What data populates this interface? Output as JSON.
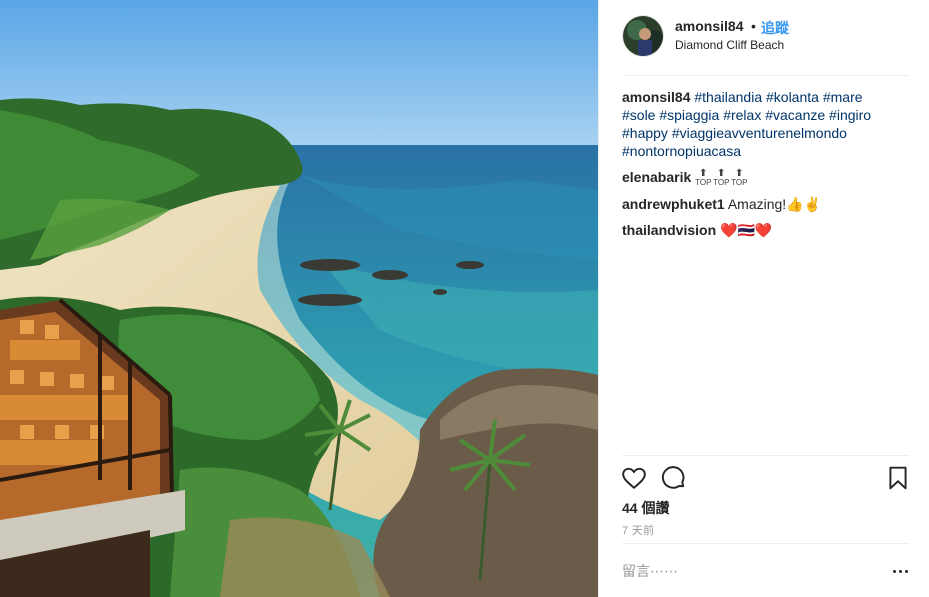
{
  "post": {
    "username": "amonsil84",
    "separator": "•",
    "follow_label": "追蹤",
    "location": "Diamond Cliff Beach"
  },
  "comments": [
    {
      "username": "amonsil84",
      "tags": [
        "#thailandia",
        "#kolanta",
        "#mare",
        "#sole",
        "#spiaggia",
        "#relax",
        "#vacanze",
        "#ingiro",
        "#happy",
        "#viaggieavventurenelmondo",
        "#nontornopiuacasa"
      ]
    },
    {
      "username": "elenabarik",
      "emoji_label": "TOP",
      "emoji_arrow": "⬆"
    },
    {
      "username": "andrewphuket1",
      "text": "Amazing!",
      "emoji": "👍✌️"
    },
    {
      "username": "thailandvision",
      "emoji": "❤️🇹🇭❤️"
    }
  ],
  "actions": {
    "like_icon": "heart-icon",
    "comment_icon": "comment-bubble-icon",
    "save_icon": "bookmark-icon"
  },
  "likes_text": "44 個讚",
  "time_text": "7 天前",
  "comment_box": {
    "placeholder": "留言⋯⋯",
    "more_icon": "more-options-icon"
  },
  "colors": {
    "link_blue": "#3897f0",
    "hashtag": "#003569",
    "text": "#262626",
    "muted": "#999999",
    "divider": "#efefef"
  }
}
